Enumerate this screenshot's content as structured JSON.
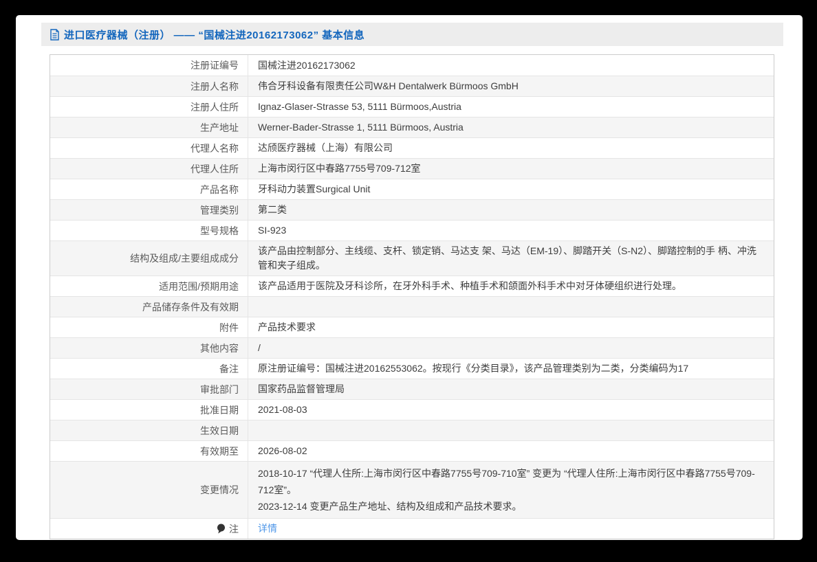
{
  "header": {
    "icon": "document-icon",
    "title": "进口医疗器械（注册） —— “国械注进20162173062” 基本信息"
  },
  "colors": {
    "page_background": "#000000",
    "panel_background": "#ffffff",
    "header_bar_background": "#ededed",
    "title_blue": "#1366bd",
    "link_blue": "#4f97e8",
    "row_stripe": "#f5f5f5",
    "table_border": "#cccccc",
    "inner_border": "#e5e5e5",
    "label_text": "#5b5b5b",
    "value_text": "#3d3d3d"
  },
  "table": {
    "rows": [
      {
        "label": "注册证编号",
        "value": "国械注进20162173062"
      },
      {
        "label": "注册人名称",
        "value": "伟合牙科设备有限责任公司W&H Dentalwerk Bürmoos GmbH"
      },
      {
        "label": "注册人住所",
        "value": "Ignaz-Glaser-Strasse 53, 5111 Bürmoos,Austria"
      },
      {
        "label": "生产地址",
        "value": "Werner-Bader-Strasse 1, 5111 Bürmoos, Austria"
      },
      {
        "label": "代理人名称",
        "value": "达颀医疗器械（上海）有限公司"
      },
      {
        "label": "代理人住所",
        "value": "上海市闵行区中春路7755号709-712室"
      },
      {
        "label": "产品名称",
        "value": "牙科动力装置Surgical Unit"
      },
      {
        "label": "管理类别",
        "value": "第二类"
      },
      {
        "label": "型号规格",
        "value": "SI-923"
      },
      {
        "label": "结构及组成/主要组成成分",
        "value": "该产品由控制部分、主线缆、支杆、锁定销、马达支 架、马达（EM-19）、脚踏开关（S-N2）、脚踏控制的手 柄、冲洗管和夹子组成。"
      },
      {
        "label": "适用范围/预期用途",
        "value": "该产品适用于医院及牙科诊所，在牙外科手术、种植手术和颌面外科手术中对牙体硬组织进行处理。"
      },
      {
        "label": "产品储存条件及有效期",
        "value": ""
      },
      {
        "label": "附件",
        "value": "产品技术要求"
      },
      {
        "label": "其他内容",
        "value": "/"
      },
      {
        "label": "备注",
        "value": "原注册证编号：国械注进20162553062。按现行《分类目录》，该产品管理类别为二类，分类编码为17"
      },
      {
        "label": "审批部门",
        "value": "国家药品监督管理局"
      },
      {
        "label": "批准日期",
        "value": "2021-08-03"
      },
      {
        "label": "生效日期",
        "value": ""
      },
      {
        "label": "有效期至",
        "value": "2026-08-02"
      },
      {
        "label": "变更情况",
        "lines": [
          "2018-10-17 “代理人住所:上海市闵行区中春路7755号709-710室” 变更为 “代理人住所:上海市闵行区中春路7755号709-712室”。",
          "2023-12-14 变更产品生产地址、结构及组成和产品技术要求。"
        ]
      },
      {
        "label": "注",
        "label_icon": "comment-icon",
        "link": "详情"
      }
    ]
  }
}
